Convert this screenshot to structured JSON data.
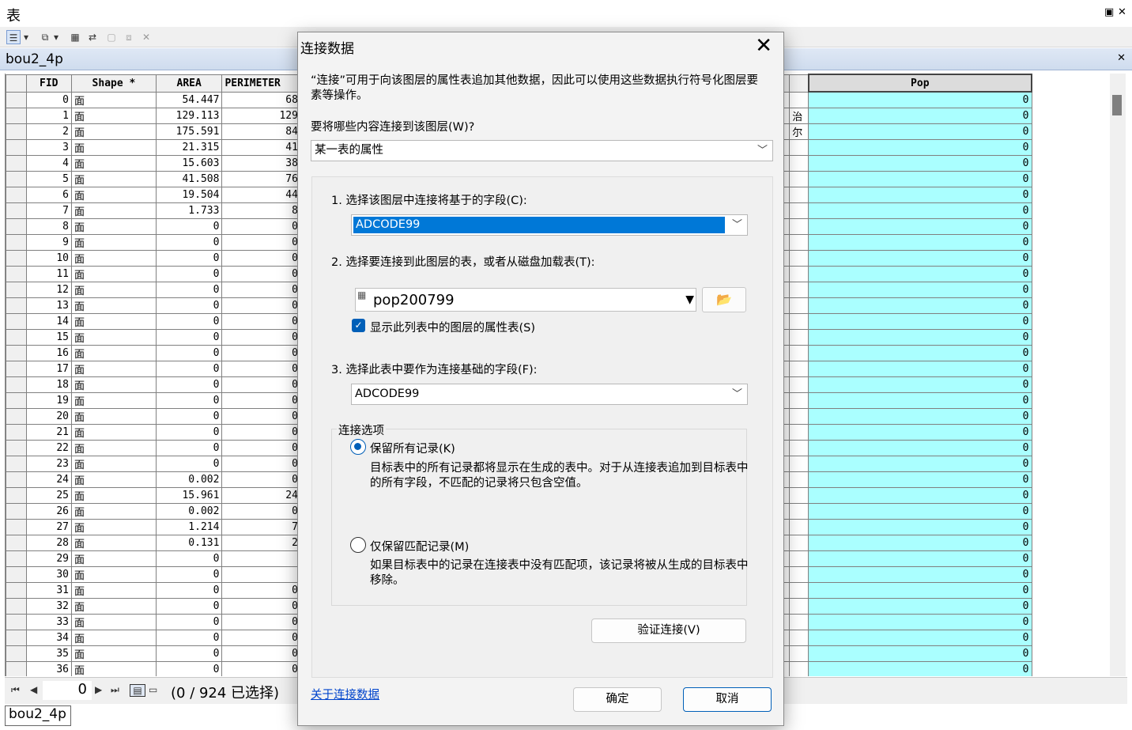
{
  "window": {
    "title": "表"
  },
  "layer": {
    "tab_name": "bou2_4p"
  },
  "table": {
    "columns": [
      "FID",
      "Shape *",
      "AREA",
      "PERIMETER"
    ],
    "pop_header": "Pop",
    "partial_col_values": [
      "治",
      "尔"
    ],
    "rows": [
      {
        "fid": "0",
        "shape": "面",
        "area": "54.447",
        "perim": "68",
        "pop": "0"
      },
      {
        "fid": "1",
        "shape": "面",
        "area": "129.113",
        "perim": "129",
        "pop": "0"
      },
      {
        "fid": "2",
        "shape": "面",
        "area": "175.591",
        "perim": "84",
        "pop": "0"
      },
      {
        "fid": "3",
        "shape": "面",
        "area": "21.315",
        "perim": "41",
        "pop": "0"
      },
      {
        "fid": "4",
        "shape": "面",
        "area": "15.603",
        "perim": "38",
        "pop": "0"
      },
      {
        "fid": "5",
        "shape": "面",
        "area": "41.508",
        "perim": "76",
        "pop": "0"
      },
      {
        "fid": "6",
        "shape": "面",
        "area": "19.504",
        "perim": "44",
        "pop": "0"
      },
      {
        "fid": "7",
        "shape": "面",
        "area": "1.733",
        "perim": "8",
        "pop": "0"
      },
      {
        "fid": "8",
        "shape": "面",
        "area": "0",
        "perim": "0",
        "pop": "0"
      },
      {
        "fid": "9",
        "shape": "面",
        "area": "0",
        "perim": "0",
        "pop": "0"
      },
      {
        "fid": "10",
        "shape": "面",
        "area": "0",
        "perim": "0",
        "pop": "0"
      },
      {
        "fid": "11",
        "shape": "面",
        "area": "0",
        "perim": "0",
        "pop": "0"
      },
      {
        "fid": "12",
        "shape": "面",
        "area": "0",
        "perim": "0",
        "pop": "0"
      },
      {
        "fid": "13",
        "shape": "面",
        "area": "0",
        "perim": "0",
        "pop": "0"
      },
      {
        "fid": "14",
        "shape": "面",
        "area": "0",
        "perim": "0",
        "pop": "0"
      },
      {
        "fid": "15",
        "shape": "面",
        "area": "0",
        "perim": "0",
        "pop": "0"
      },
      {
        "fid": "16",
        "shape": "面",
        "area": "0",
        "perim": "0",
        "pop": "0"
      },
      {
        "fid": "17",
        "shape": "面",
        "area": "0",
        "perim": "0",
        "pop": "0"
      },
      {
        "fid": "18",
        "shape": "面",
        "area": "0",
        "perim": "0",
        "pop": "0"
      },
      {
        "fid": "19",
        "shape": "面",
        "area": "0",
        "perim": "0",
        "pop": "0"
      },
      {
        "fid": "20",
        "shape": "面",
        "area": "0",
        "perim": "0",
        "pop": "0"
      },
      {
        "fid": "21",
        "shape": "面",
        "area": "0",
        "perim": "0",
        "pop": "0"
      },
      {
        "fid": "22",
        "shape": "面",
        "area": "0",
        "perim": "0",
        "pop": "0"
      },
      {
        "fid": "23",
        "shape": "面",
        "area": "0",
        "perim": "0",
        "pop": "0"
      },
      {
        "fid": "24",
        "shape": "面",
        "area": "0.002",
        "perim": "0",
        "pop": "0"
      },
      {
        "fid": "25",
        "shape": "面",
        "area": "15.961",
        "perim": "24",
        "pop": "0"
      },
      {
        "fid": "26",
        "shape": "面",
        "area": "0.002",
        "perim": "0",
        "pop": "0"
      },
      {
        "fid": "27",
        "shape": "面",
        "area": "1.214",
        "perim": "7",
        "pop": "0"
      },
      {
        "fid": "28",
        "shape": "面",
        "area": "0.131",
        "perim": "2",
        "pop": "0"
      },
      {
        "fid": "29",
        "shape": "面",
        "area": "0",
        "perim": "",
        "pop": "0"
      },
      {
        "fid": "30",
        "shape": "面",
        "area": "0",
        "perim": "",
        "pop": "0"
      },
      {
        "fid": "31",
        "shape": "面",
        "area": "0",
        "perim": "0",
        "pop": "0"
      },
      {
        "fid": "32",
        "shape": "面",
        "area": "0",
        "perim": "0",
        "pop": "0"
      },
      {
        "fid": "33",
        "shape": "面",
        "area": "0",
        "perim": "0",
        "pop": "0"
      },
      {
        "fid": "34",
        "shape": "面",
        "area": "0",
        "perim": "0",
        "pop": "0"
      },
      {
        "fid": "35",
        "shape": "面",
        "area": "0",
        "perim": "0",
        "pop": "0"
      },
      {
        "fid": "36",
        "shape": "面",
        "area": "0",
        "perim": "0",
        "pop": "0"
      }
    ]
  },
  "nav": {
    "record": "0",
    "count_text": "(0 / 924 已选择)"
  },
  "dialog": {
    "title": "连接数据",
    "description": "“连接”可用于向该图层的属性表追加其他数据，因此可以使用这些数据执行符号化图层要素等操作。",
    "question": "要将哪些内容连接到该图层(W)?",
    "join_type": "某一表的属性",
    "step1": "1. 选择该图层中连接将基于的字段(C):",
    "step1_value": "ADCODE99",
    "step2": "2. 选择要连接到此图层的表，或者从磁盘加载表(T):",
    "step2_value": "pop200799",
    "show_layers_label": "显示此列表中的图层的属性表(S)",
    "step3": "3. 选择此表中要作为连接基础的字段(F):",
    "step3_value": "ADCODE99",
    "options_legend": "连接选项",
    "keep_all_label": "保留所有记录(K)",
    "keep_all_desc": "目标表中的所有记录都将显示在生成的表中。对于从连接表追加到目标表中的所有字段，不匹配的记录将只包含空值。",
    "keep_match_label": "仅保留匹配记录(M)",
    "keep_match_desc": "如果目标表中的记录在连接表中没有匹配项，该记录将被从生成的目标表中移除。",
    "validate_button": "验证连接(V)",
    "about_link": "关于连接数据",
    "ok_button": "确定",
    "cancel_button": "取消"
  }
}
